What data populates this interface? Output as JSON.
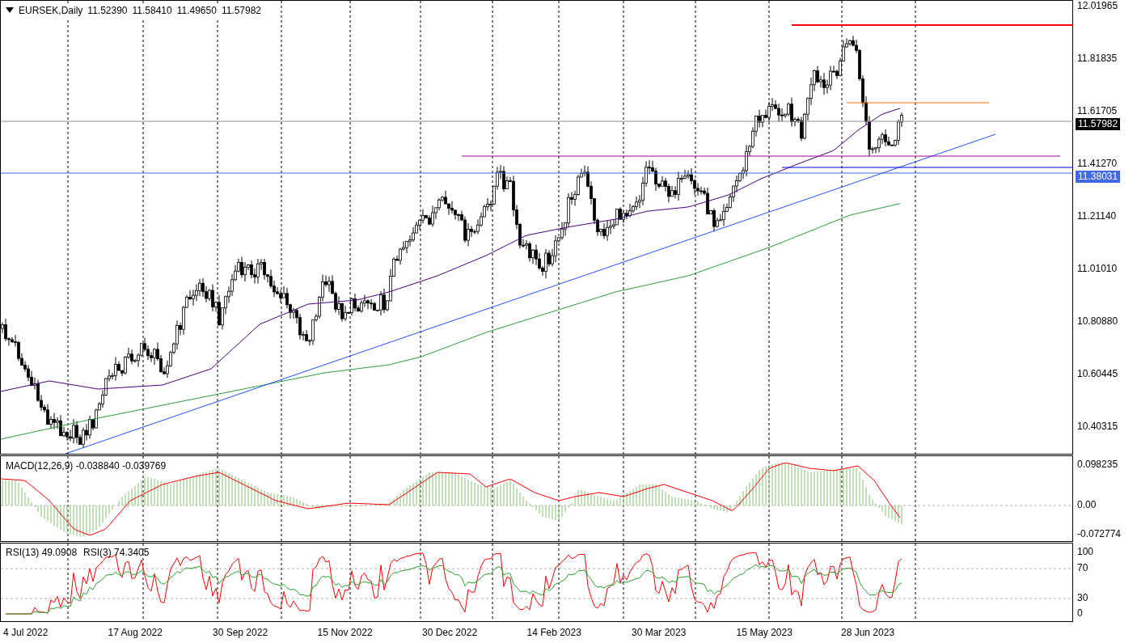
{
  "header": {
    "symbol": "EURSEK,Daily",
    "values": [
      "11.52390",
      "11.58410",
      "11.49650",
      "11.57982"
    ]
  },
  "price_axis": {
    "labels": [
      "12.01965",
      "11.81835",
      "11.61705",
      "11.41270",
      "11.21140",
      "11.01010",
      "10.80880",
      "10.60445",
      "10.40315"
    ]
  },
  "price_tags": [
    {
      "kind": "bid",
      "text": "11.57982"
    },
    {
      "kind": "line",
      "text": "11.38031"
    }
  ],
  "macd": {
    "label": "MACD(12,26,9) -0.038840 -0.039769",
    "axis_labels": [
      "0.098235",
      "0.00",
      "-0.072774"
    ]
  },
  "rsi": {
    "labels": [
      "RSI(13) 49.0908",
      "RSI(3) 74.3405"
    ],
    "axis_labels": [
      "100",
      "70",
      "30",
      "0"
    ]
  },
  "date_axis": {
    "labels": [
      "4 Jul 2022",
      "17 Aug 2022",
      "30 Sep 2022",
      "15 Nov 2022",
      "30 Dec 2022",
      "14 Feb 2023",
      "30 Mar 2023",
      "15 May 2023",
      "28 Jun 2023"
    ]
  }
}
